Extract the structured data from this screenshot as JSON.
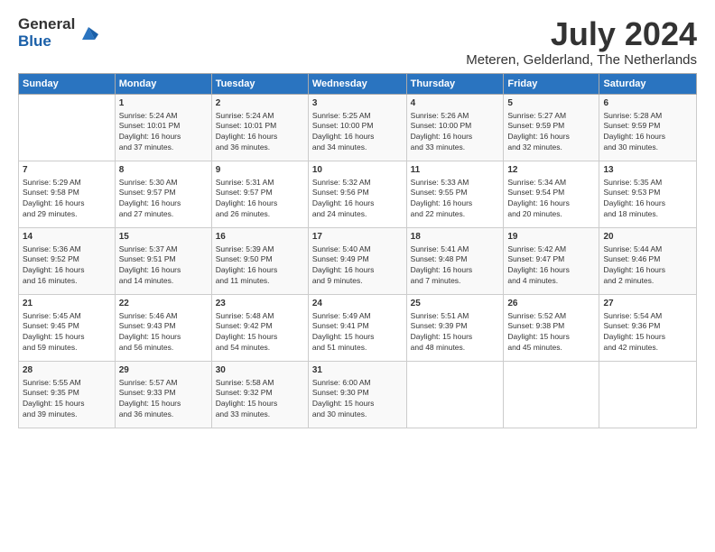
{
  "logo": {
    "general": "General",
    "blue": "Blue"
  },
  "title": "July 2024",
  "location": "Meteren, Gelderland, The Netherlands",
  "headers": [
    "Sunday",
    "Monday",
    "Tuesday",
    "Wednesday",
    "Thursday",
    "Friday",
    "Saturday"
  ],
  "weeks": [
    [
      {
        "day": "",
        "data": ""
      },
      {
        "day": "1",
        "data": "Sunrise: 5:24 AM\nSunset: 10:01 PM\nDaylight: 16 hours\nand 37 minutes."
      },
      {
        "day": "2",
        "data": "Sunrise: 5:24 AM\nSunset: 10:01 PM\nDaylight: 16 hours\nand 36 minutes."
      },
      {
        "day": "3",
        "data": "Sunrise: 5:25 AM\nSunset: 10:00 PM\nDaylight: 16 hours\nand 34 minutes."
      },
      {
        "day": "4",
        "data": "Sunrise: 5:26 AM\nSunset: 10:00 PM\nDaylight: 16 hours\nand 33 minutes."
      },
      {
        "day": "5",
        "data": "Sunrise: 5:27 AM\nSunset: 9:59 PM\nDaylight: 16 hours\nand 32 minutes."
      },
      {
        "day": "6",
        "data": "Sunrise: 5:28 AM\nSunset: 9:59 PM\nDaylight: 16 hours\nand 30 minutes."
      }
    ],
    [
      {
        "day": "7",
        "data": "Sunrise: 5:29 AM\nSunset: 9:58 PM\nDaylight: 16 hours\nand 29 minutes."
      },
      {
        "day": "8",
        "data": "Sunrise: 5:30 AM\nSunset: 9:57 PM\nDaylight: 16 hours\nand 27 minutes."
      },
      {
        "day": "9",
        "data": "Sunrise: 5:31 AM\nSunset: 9:57 PM\nDaylight: 16 hours\nand 26 minutes."
      },
      {
        "day": "10",
        "data": "Sunrise: 5:32 AM\nSunset: 9:56 PM\nDaylight: 16 hours\nand 24 minutes."
      },
      {
        "day": "11",
        "data": "Sunrise: 5:33 AM\nSunset: 9:55 PM\nDaylight: 16 hours\nand 22 minutes."
      },
      {
        "day": "12",
        "data": "Sunrise: 5:34 AM\nSunset: 9:54 PM\nDaylight: 16 hours\nand 20 minutes."
      },
      {
        "day": "13",
        "data": "Sunrise: 5:35 AM\nSunset: 9:53 PM\nDaylight: 16 hours\nand 18 minutes."
      }
    ],
    [
      {
        "day": "14",
        "data": "Sunrise: 5:36 AM\nSunset: 9:52 PM\nDaylight: 16 hours\nand 16 minutes."
      },
      {
        "day": "15",
        "data": "Sunrise: 5:37 AM\nSunset: 9:51 PM\nDaylight: 16 hours\nand 14 minutes."
      },
      {
        "day": "16",
        "data": "Sunrise: 5:39 AM\nSunset: 9:50 PM\nDaylight: 16 hours\nand 11 minutes."
      },
      {
        "day": "17",
        "data": "Sunrise: 5:40 AM\nSunset: 9:49 PM\nDaylight: 16 hours\nand 9 minutes."
      },
      {
        "day": "18",
        "data": "Sunrise: 5:41 AM\nSunset: 9:48 PM\nDaylight: 16 hours\nand 7 minutes."
      },
      {
        "day": "19",
        "data": "Sunrise: 5:42 AM\nSunset: 9:47 PM\nDaylight: 16 hours\nand 4 minutes."
      },
      {
        "day": "20",
        "data": "Sunrise: 5:44 AM\nSunset: 9:46 PM\nDaylight: 16 hours\nand 2 minutes."
      }
    ],
    [
      {
        "day": "21",
        "data": "Sunrise: 5:45 AM\nSunset: 9:45 PM\nDaylight: 15 hours\nand 59 minutes."
      },
      {
        "day": "22",
        "data": "Sunrise: 5:46 AM\nSunset: 9:43 PM\nDaylight: 15 hours\nand 56 minutes."
      },
      {
        "day": "23",
        "data": "Sunrise: 5:48 AM\nSunset: 9:42 PM\nDaylight: 15 hours\nand 54 minutes."
      },
      {
        "day": "24",
        "data": "Sunrise: 5:49 AM\nSunset: 9:41 PM\nDaylight: 15 hours\nand 51 minutes."
      },
      {
        "day": "25",
        "data": "Sunrise: 5:51 AM\nSunset: 9:39 PM\nDaylight: 15 hours\nand 48 minutes."
      },
      {
        "day": "26",
        "data": "Sunrise: 5:52 AM\nSunset: 9:38 PM\nDaylight: 15 hours\nand 45 minutes."
      },
      {
        "day": "27",
        "data": "Sunrise: 5:54 AM\nSunset: 9:36 PM\nDaylight: 15 hours\nand 42 minutes."
      }
    ],
    [
      {
        "day": "28",
        "data": "Sunrise: 5:55 AM\nSunset: 9:35 PM\nDaylight: 15 hours\nand 39 minutes."
      },
      {
        "day": "29",
        "data": "Sunrise: 5:57 AM\nSunset: 9:33 PM\nDaylight: 15 hours\nand 36 minutes."
      },
      {
        "day": "30",
        "data": "Sunrise: 5:58 AM\nSunset: 9:32 PM\nDaylight: 15 hours\nand 33 minutes."
      },
      {
        "day": "31",
        "data": "Sunrise: 6:00 AM\nSunset: 9:30 PM\nDaylight: 15 hours\nand 30 minutes."
      },
      {
        "day": "",
        "data": ""
      },
      {
        "day": "",
        "data": ""
      },
      {
        "day": "",
        "data": ""
      }
    ]
  ]
}
